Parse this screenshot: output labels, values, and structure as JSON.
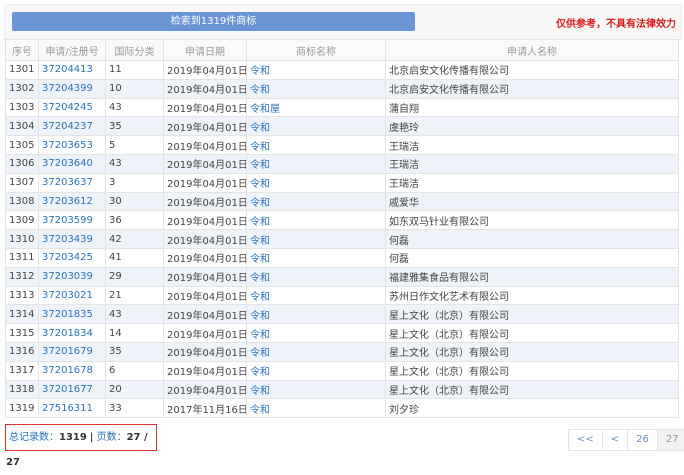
{
  "banner": "检索到1319件商标",
  "notice": "仅供参考，不具有法律效力",
  "columns": [
    "序号",
    "申请/注册号",
    "国际分类",
    "申请日期",
    "商标名称",
    "申请人名称"
  ],
  "rows": [
    [
      "1301",
      "37204413",
      "11",
      "2019年04月01日",
      "令和",
      "北京启安文化传播有限公司"
    ],
    [
      "1302",
      "37204399",
      "10",
      "2019年04月01日",
      "令和",
      "北京启安文化传播有限公司"
    ],
    [
      "1303",
      "37204245",
      "43",
      "2019年04月01日",
      "令和屋",
      "蒲自翔"
    ],
    [
      "1304",
      "37204237",
      "35",
      "2019年04月01日",
      "令和",
      "虞艳玲"
    ],
    [
      "1305",
      "37203653",
      "5",
      "2019年04月01日",
      "令和",
      "王瑞洁"
    ],
    [
      "1306",
      "37203640",
      "43",
      "2019年04月01日",
      "令和",
      "王瑞洁"
    ],
    [
      "1307",
      "37203637",
      "3",
      "2019年04月01日",
      "令和",
      "王瑞洁"
    ],
    [
      "1308",
      "37203612",
      "30",
      "2019年04月01日",
      "令和",
      "戚爱华"
    ],
    [
      "1309",
      "37203599",
      "36",
      "2019年04月01日",
      "令和",
      "如东双马针业有限公司"
    ],
    [
      "1310",
      "37203439",
      "42",
      "2019年04月01日",
      "令和",
      "何磊"
    ],
    [
      "1311",
      "37203425",
      "41",
      "2019年04月01日",
      "令和",
      "何磊"
    ],
    [
      "1312",
      "37203039",
      "29",
      "2019年04月01日",
      "令和",
      "福建雅集食品有限公司"
    ],
    [
      "1313",
      "37203021",
      "21",
      "2019年04月01日",
      "令和",
      "苏州日作文化艺术有限公司"
    ],
    [
      "1314",
      "37201835",
      "43",
      "2019年04月01日",
      "令和",
      "星上文化（北京）有限公司"
    ],
    [
      "1315",
      "37201834",
      "14",
      "2019年04月01日",
      "令和",
      "星上文化（北京）有限公司"
    ],
    [
      "1316",
      "37201679",
      "35",
      "2019年04月01日",
      "令和",
      "星上文化（北京）有限公司"
    ],
    [
      "1317",
      "37201678",
      "6",
      "2019年04月01日",
      "令和",
      "星上文化（北京）有限公司"
    ],
    [
      "1318",
      "37201677",
      "20",
      "2019年04月01日",
      "令和",
      "星上文化（北京）有限公司"
    ],
    [
      "1319",
      "27516311",
      "33",
      "2017年11月16日",
      "令和",
      "刘夕珍"
    ]
  ],
  "footer": {
    "total_label": "总记录数：",
    "total": "1319",
    "sep": " | ",
    "pages_label": "页数：",
    "pages": "27 / 27"
  },
  "pager": [
    "<<",
    "<",
    "26",
    "27"
  ]
}
